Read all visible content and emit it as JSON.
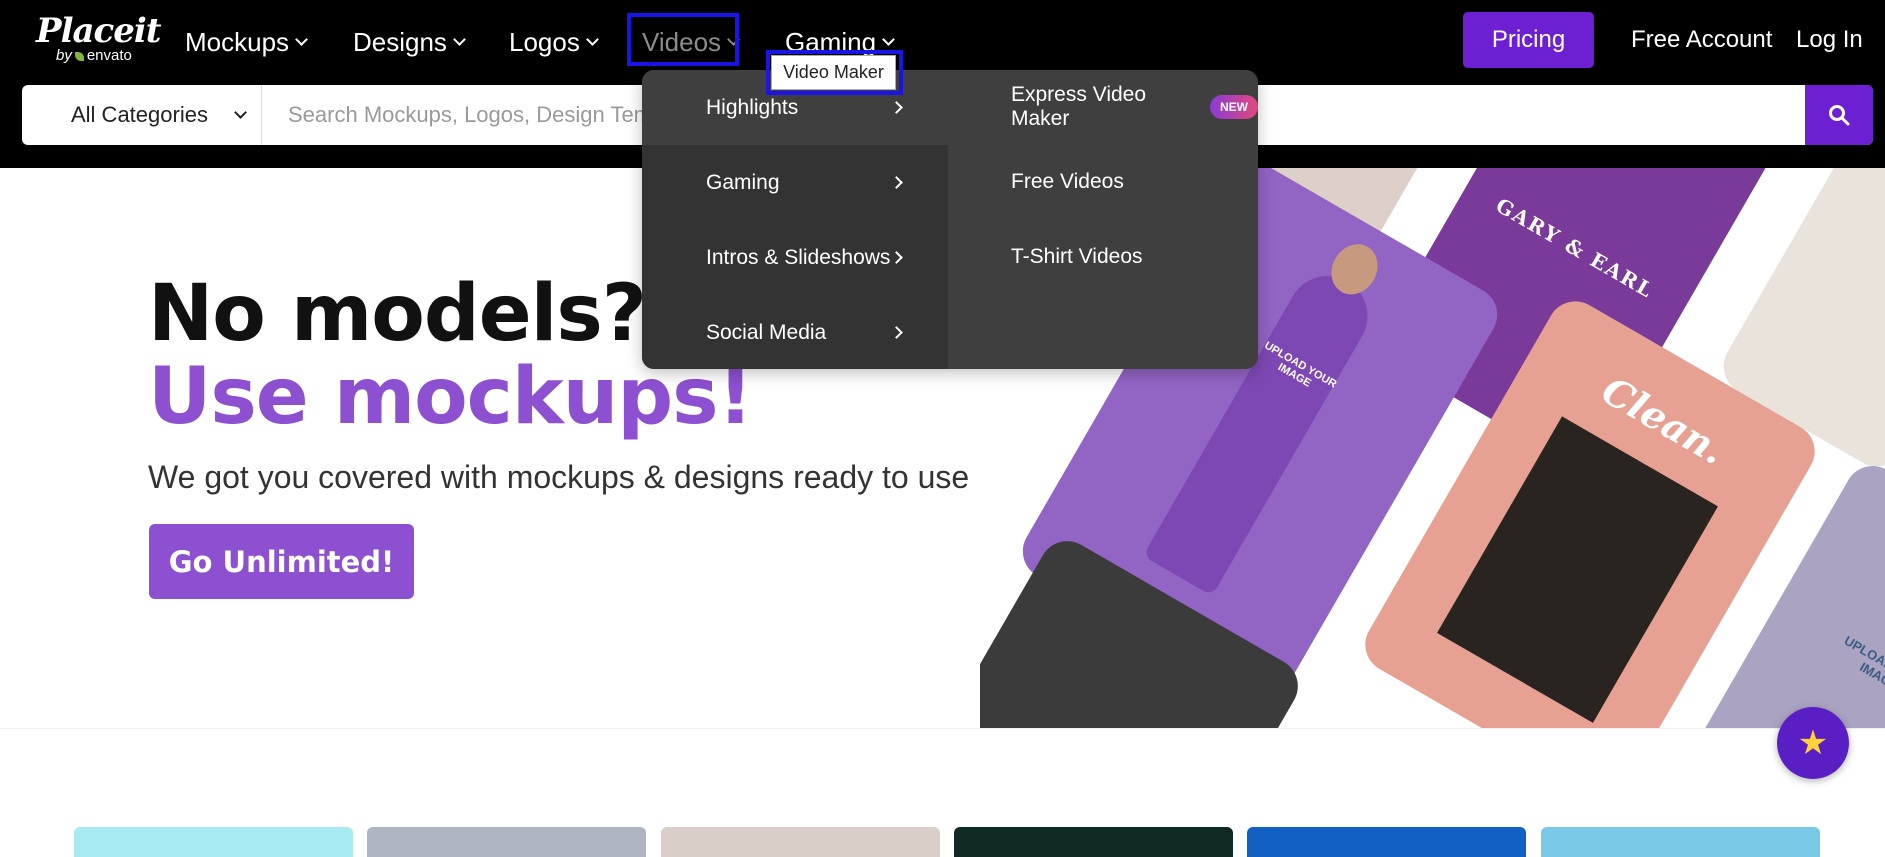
{
  "logo": {
    "word": "Placeit",
    "by": "by",
    "brand": "envato"
  },
  "nav": [
    {
      "label": "Mockups"
    },
    {
      "label": "Designs"
    },
    {
      "label": "Logos"
    },
    {
      "label": "Videos"
    },
    {
      "label": "Gaming"
    }
  ],
  "header": {
    "pricing": "Pricing",
    "free_account": "Free Account",
    "login": "Log In"
  },
  "search": {
    "category": "All Categories",
    "placeholder": "Search Mockups, Logos, Design Templates and more"
  },
  "tooltip": "Video Maker",
  "dropdown": {
    "left": [
      "Highlights",
      "Gaming",
      "Intros & Slideshows",
      "Social Media"
    ],
    "right": [
      "Express Video Maker",
      "Free Videos",
      "T-Shirt Videos"
    ],
    "badge": "NEW"
  },
  "hero": {
    "line1": "No models? No problem!",
    "line2": "Use mockups!",
    "subtitle": "We got you covered with mockups & designs ready to use",
    "cta": "Go Unlimited!"
  },
  "collage": {
    "card1": "GARY & EARL",
    "card2": "Clean.",
    "card3": "UPLOAD YOUR IMAGE",
    "card4": "UPLOAD YOUR IMAGE"
  },
  "colors": {
    "accent": "#6d20d2",
    "hero_purple": "#8c50d0",
    "highlight": "#1a14e6"
  },
  "icons": {
    "search": "search-icon",
    "star": "star-icon"
  }
}
